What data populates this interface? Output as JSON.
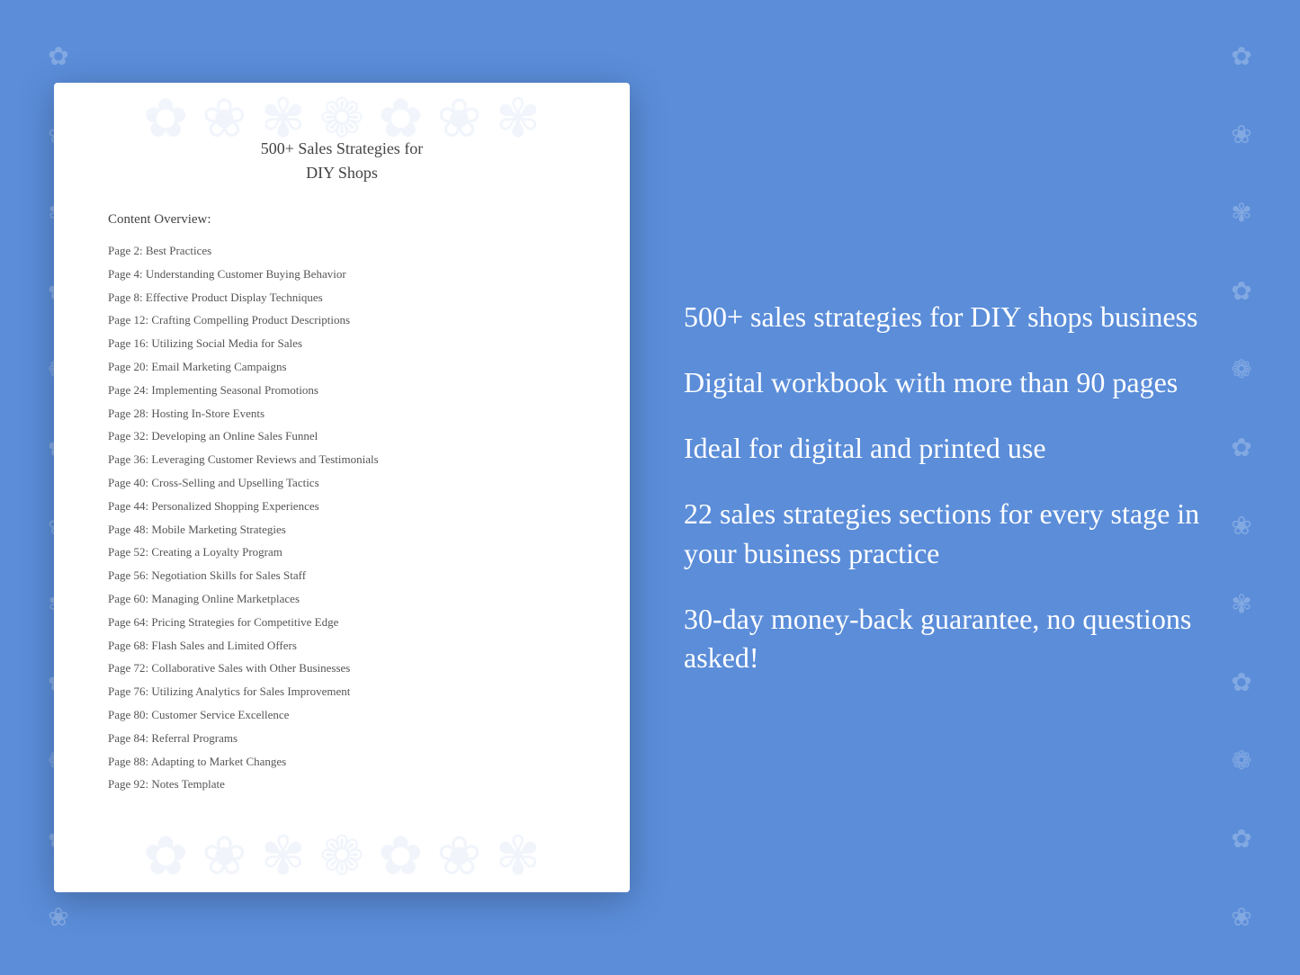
{
  "background": {
    "color": "#5b8dd9"
  },
  "document": {
    "title_line1": "500+ Sales Strategies for",
    "title_line2": "DIY Shops",
    "section_title": "Content Overview:",
    "toc_items": [
      {
        "page": "Page  2:",
        "topic": "Best Practices"
      },
      {
        "page": "Page  4:",
        "topic": "Understanding Customer Buying Behavior"
      },
      {
        "page": "Page  8:",
        "topic": "Effective Product Display Techniques"
      },
      {
        "page": "Page 12:",
        "topic": "Crafting Compelling Product Descriptions"
      },
      {
        "page": "Page 16:",
        "topic": "Utilizing Social Media for Sales"
      },
      {
        "page": "Page 20:",
        "topic": "Email Marketing Campaigns"
      },
      {
        "page": "Page 24:",
        "topic": "Implementing Seasonal Promotions"
      },
      {
        "page": "Page 28:",
        "topic": "Hosting In-Store Events"
      },
      {
        "page": "Page 32:",
        "topic": "Developing an Online Sales Funnel"
      },
      {
        "page": "Page 36:",
        "topic": "Leveraging Customer Reviews and Testimonials"
      },
      {
        "page": "Page 40:",
        "topic": "Cross-Selling and Upselling Tactics"
      },
      {
        "page": "Page 44:",
        "topic": "Personalized Shopping Experiences"
      },
      {
        "page": "Page 48:",
        "topic": "Mobile Marketing Strategies"
      },
      {
        "page": "Page 52:",
        "topic": "Creating a Loyalty Program"
      },
      {
        "page": "Page 56:",
        "topic": "Negotiation Skills for Sales Staff"
      },
      {
        "page": "Page 60:",
        "topic": "Managing Online Marketplaces"
      },
      {
        "page": "Page 64:",
        "topic": "Pricing Strategies for Competitive Edge"
      },
      {
        "page": "Page 68:",
        "topic": "Flash Sales and Limited Offers"
      },
      {
        "page": "Page 72:",
        "topic": "Collaborative Sales with Other Businesses"
      },
      {
        "page": "Page 76:",
        "topic": "Utilizing Analytics for Sales Improvement"
      },
      {
        "page": "Page 80:",
        "topic": "Customer Service Excellence"
      },
      {
        "page": "Page 84:",
        "topic": "Referral Programs"
      },
      {
        "page": "Page 88:",
        "topic": "Adapting to Market Changes"
      },
      {
        "page": "Page 92:",
        "topic": "Notes Template"
      }
    ]
  },
  "sidebar": {
    "blocks": [
      "500+ sales strategies for DIY shops business",
      "Digital workbook with more than 90 pages",
      "Ideal for digital and printed use",
      "22 sales strategies sections for every stage in your business practice",
      "30-day money-back guarantee, no questions asked!"
    ]
  },
  "floral_symbols": [
    "✿",
    "❀",
    "✾",
    "✿",
    "❁",
    "✿",
    "❀",
    "✾",
    "✿",
    "❁",
    "✿",
    "❀"
  ]
}
